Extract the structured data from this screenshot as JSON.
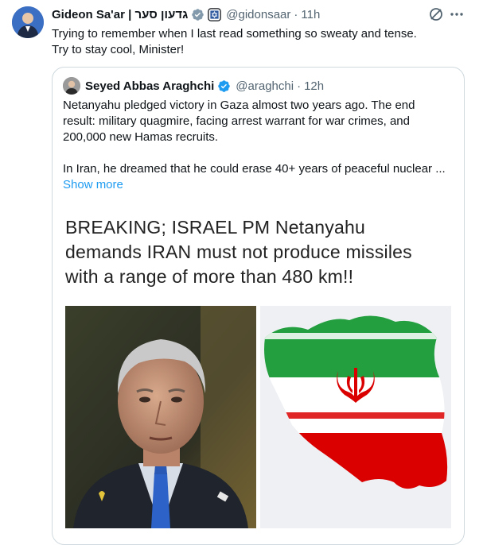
{
  "tweet": {
    "author_name": "Gideon Sa'ar | גדעון סער",
    "handle": "@gidonsaar",
    "time": "11h",
    "text_lines": [
      "Trying to remember when I last read something so sweaty and tense.",
      "Try to stay cool, Minister!"
    ]
  },
  "quoted_tweet": {
    "author_name": "Seyed Abbas Araghchi",
    "handle": "@araghchi",
    "time": "12h",
    "text_lines": [
      "Netanyahu pledged victory in Gaza almost two years ago. The end",
      "result: military quagmire, facing arrest warrant for war crimes, and",
      "200,000 new Hamas recruits.",
      "",
      "In Iran, he dreamed that he could erase 40+ years of peaceful nuclear ..."
    ],
    "show_more": "Show more",
    "image_headline_lines": [
      "BREAKING; ISRAEL PM Netanyahu",
      "demands  IRAN must not produce missiles",
      "with a range of more than 480 km!!"
    ]
  },
  "icons": {
    "verified": "verified-badge-icon",
    "org": "organization-badge-icon",
    "grok": "grok-icon",
    "more": "more-icon"
  },
  "colors": {
    "accent": "#1d9bf0",
    "text": "#0f1419",
    "muted": "#536471",
    "border": "#cfd9de",
    "flag_green": "#239f40",
    "flag_red": "#da0000"
  }
}
